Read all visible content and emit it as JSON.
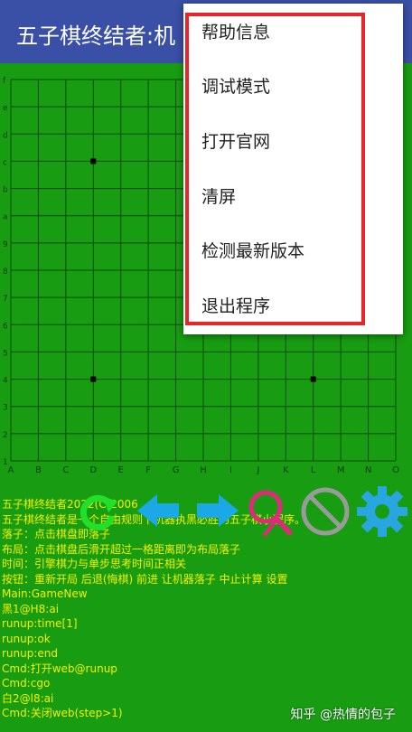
{
  "app": {
    "title": "五子棋终结者:机"
  },
  "board": {
    "row_labels": [
      "f",
      "e",
      "d",
      "c",
      "b",
      "a",
      "9",
      "8",
      "7",
      "6",
      "5",
      "4",
      "3",
      "2",
      "1"
    ],
    "col_labels": [
      "A",
      "B",
      "C",
      "D",
      "E",
      "F",
      "G",
      "H",
      "I",
      "J",
      "K",
      "L",
      "M",
      "N",
      "O"
    ],
    "star_points": [
      "D12",
      "D4",
      "L4"
    ]
  },
  "toolbar": {
    "buttons": [
      {
        "name": "restart",
        "icon": "refresh-icon",
        "color": "#22e02a"
      },
      {
        "name": "undo",
        "icon": "arrow-left-icon",
        "color": "#1aa8e6"
      },
      {
        "name": "redo",
        "icon": "arrow-right-icon",
        "color": "#1aa8e6"
      },
      {
        "name": "ai-move",
        "icon": "search-icon",
        "color": "#e0297a"
      },
      {
        "name": "stop",
        "icon": "prohibit-icon",
        "color": "#9a9a9a"
      },
      {
        "name": "settings",
        "icon": "gear-icon",
        "color": "#27a6e0"
      }
    ]
  },
  "log": {
    "lines": [
      "五子棋终结者2022(C)2006",
      "五子棋终结者是一个自由规则下机器执黑必胜的五子棋小程序。",
      "落子：点击棋盘即落子",
      "布局：点击棋盘后滑开超过一格距离即为布局落子",
      "时间：引擎棋力与单步思考时间正相关",
      "按钮：重新开局 后退(悔棋) 前进 让机器落子 中止计算 设置",
      "Main:GameNew",
      "黑1@H8:ai",
      "runup:time[1]",
      "runup:ok",
      "runup:end",
      "Cmd:打开web@runup",
      "Cmd:cgo",
      "白2@l8:ai",
      "Cmd:关闭web(step>1)"
    ]
  },
  "watermark": "知乎 @热情的包子",
  "menu": {
    "items": [
      "帮助信息",
      "调试模式",
      "打开官网",
      "清屏",
      "检测最新版本",
      "退出程序"
    ]
  },
  "colors": {
    "title_bar": "#3a4fa6",
    "board_bg": "#189d12",
    "grid_line": "#0c4a08",
    "log_text": "#f4f000",
    "highlight_box": "#e8262a"
  }
}
